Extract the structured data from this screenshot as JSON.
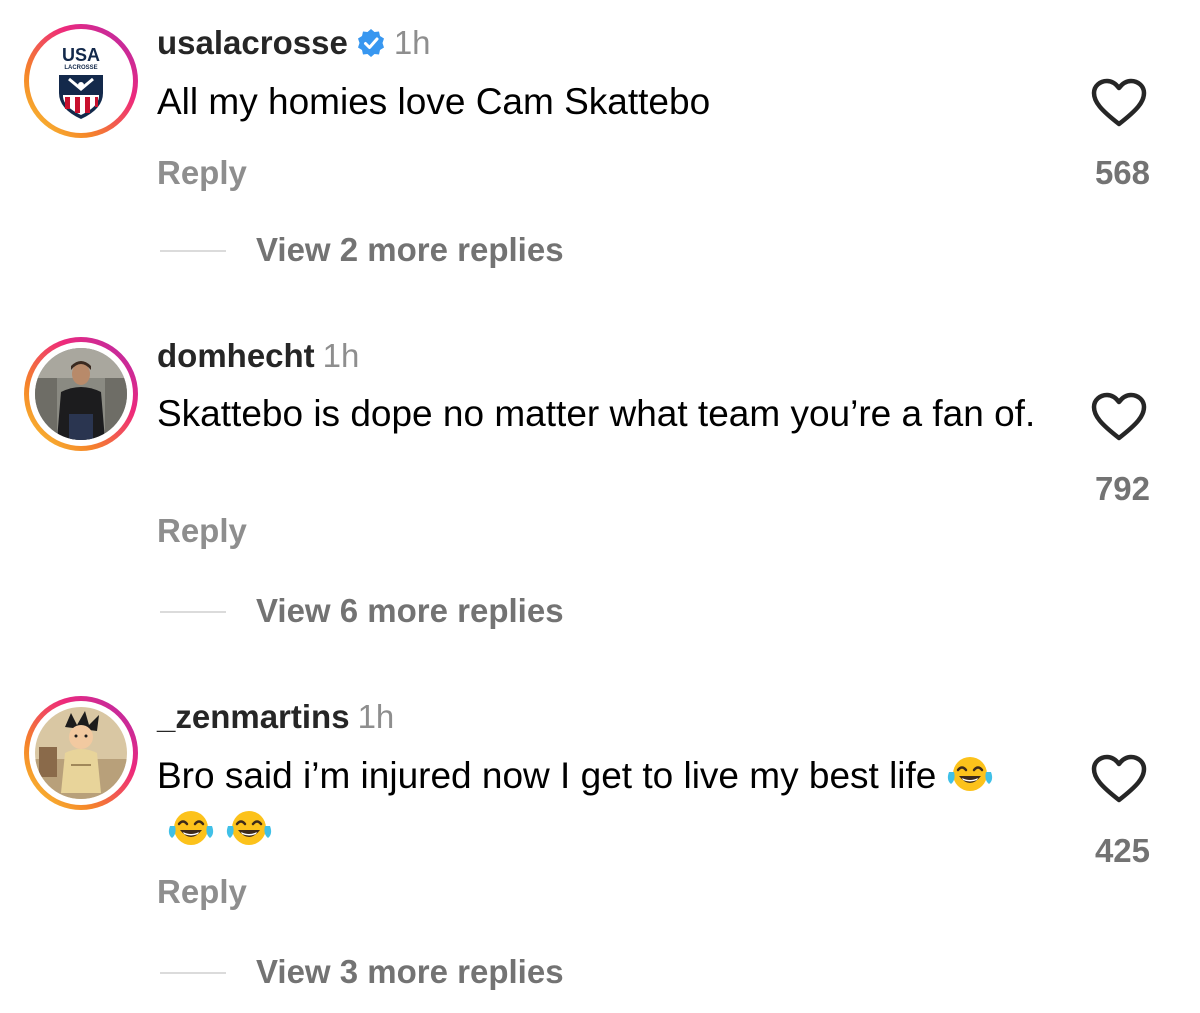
{
  "comments": [
    {
      "username": "usalacrosse",
      "verified": true,
      "time": "1h",
      "text": "All my homies love Cam Skattebo",
      "reply_label": "Reply",
      "likes": "568",
      "view_replies": "View 2 more replies",
      "avatar_logo_text": "USA",
      "avatar_logo_subtext": "LACROSSE"
    },
    {
      "username": "domhecht",
      "verified": false,
      "time": "1h",
      "text": "Skattebo is dope no matter what team you’re a fan of.",
      "reply_label": "Reply",
      "likes": "792",
      "view_replies": "View 6 more replies"
    },
    {
      "username": "_zenmartins",
      "verified": false,
      "time": "1h",
      "text": "Bro said i’m injured now I get to live my best life",
      "emojis": [
        "face-with-tears-of-joy",
        "face-with-tears-of-joy",
        "face-with-tears-of-joy"
      ],
      "reply_label": "Reply",
      "likes": "425",
      "view_replies": "View 3 more replies"
    }
  ],
  "colors": {
    "username": "#262626",
    "secondary": "#8e8e8e",
    "verified_blue": "#3897f0",
    "ring_gradient": [
      "#f9ce34",
      "#ee2a7b",
      "#b02a9c"
    ]
  }
}
